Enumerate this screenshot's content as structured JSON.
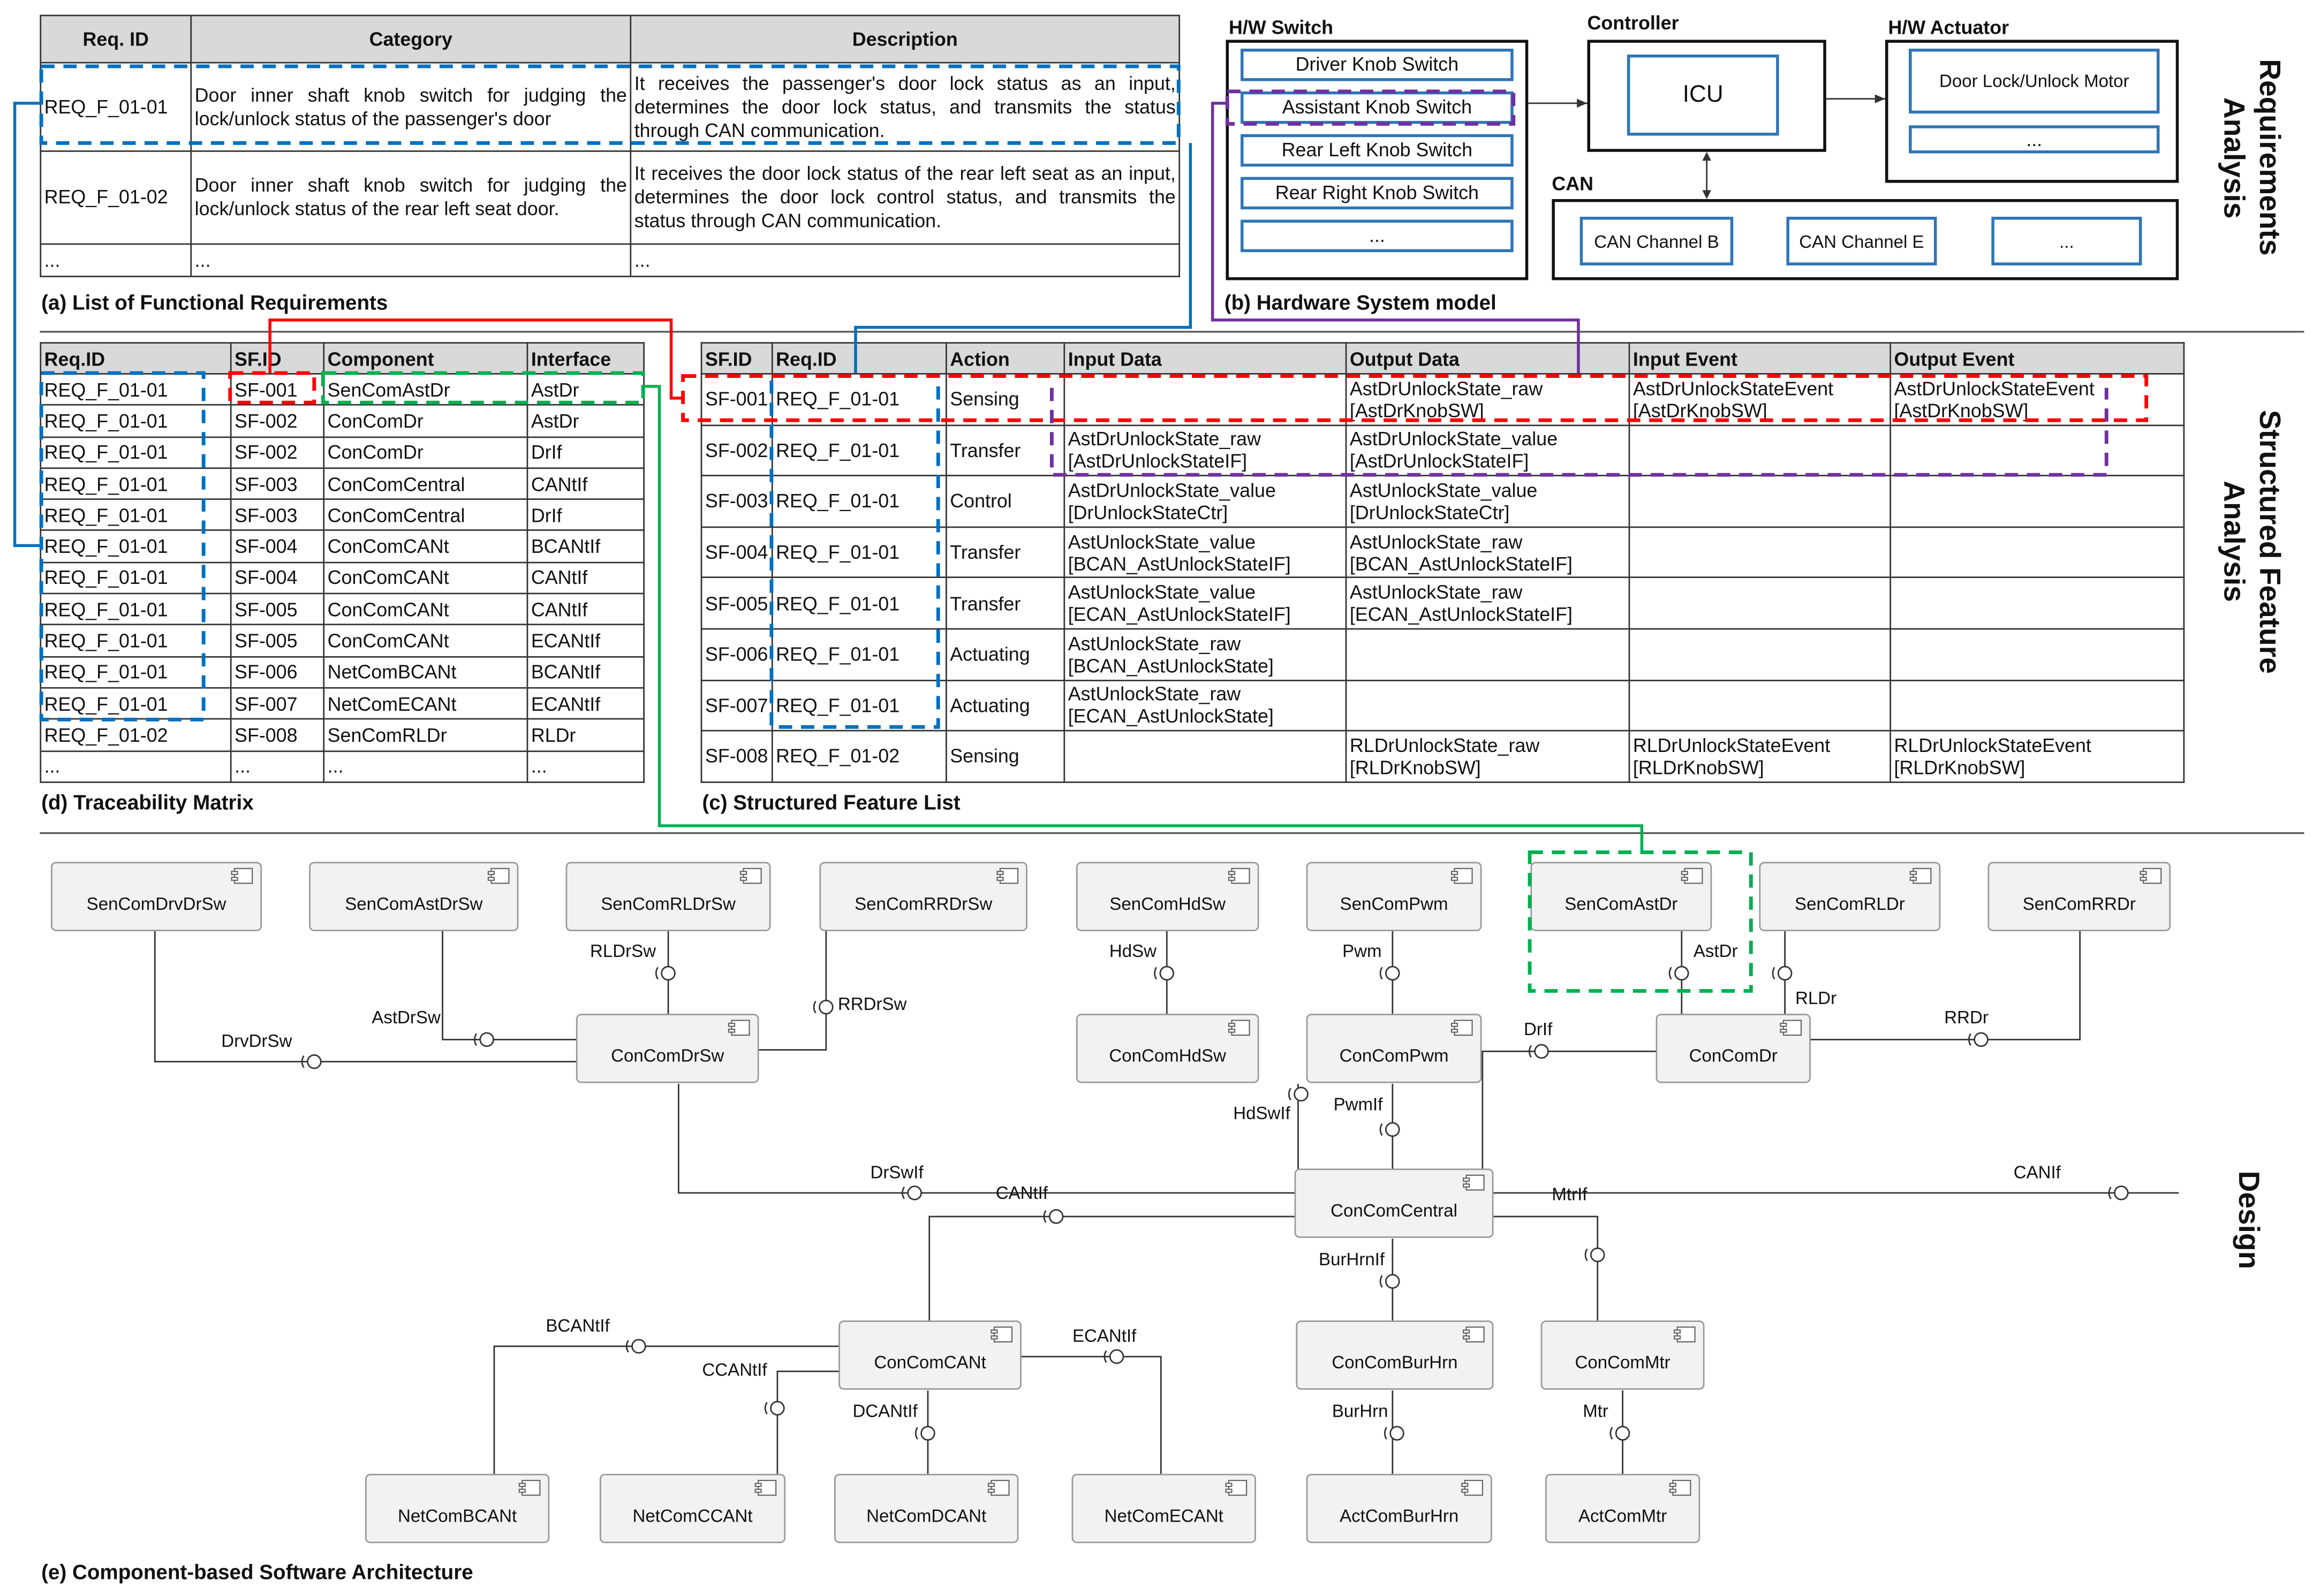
{
  "requirements_table": {
    "caption": "(a) List of Functional Requirements",
    "headers": [
      "Req. ID",
      "Category",
      "Description"
    ],
    "rows": [
      [
        "REQ_F_01-01",
        "Door inner shaft knob switch for judging the lock/unlock status of the passenger's door",
        "It receives the passenger's door lock status as an input, determines the door lock status, and transmits the status through CAN communication."
      ],
      [
        "REQ_F_01-02",
        "Door inner shaft knob switch for judging the lock/unlock status of the rear left seat door.",
        "It receives the door lock status of the rear left seat as an input, determines the door lock control status, and transmits the status through CAN communication."
      ],
      [
        "...",
        "...",
        "..."
      ]
    ]
  },
  "hardware_model": {
    "caption": "(b) Hardware System model",
    "switch_group": "H/W Switch",
    "switches": [
      "Driver Knob Switch",
      "Assistant Knob Switch",
      "Rear Left Knob Switch",
      "Rear Right Knob Switch",
      "..."
    ],
    "controller_group": "Controller",
    "controller": "ICU",
    "actuator_group": "H/W Actuator",
    "actuators": [
      "Door Lock/Unlock Motor",
      "..."
    ],
    "can_group": "CAN",
    "can_channels": [
      "CAN Channel B",
      "CAN Channel E",
      "..."
    ]
  },
  "traceability_matrix": {
    "caption": "(d) Traceability Matrix",
    "headers": [
      "Req.ID",
      "SF.ID",
      "Component",
      "Interface"
    ],
    "rows": [
      [
        "REQ_F_01-01",
        "SF-001",
        "SenComAstDr",
        "AstDr"
      ],
      [
        "REQ_F_01-01",
        "SF-002",
        "ConComDr",
        "AstDr"
      ],
      [
        "REQ_F_01-01",
        "SF-002",
        "ConComDr",
        "DrIf"
      ],
      [
        "REQ_F_01-01",
        "SF-003",
        "ConComCentral",
        "CANtIf"
      ],
      [
        "REQ_F_01-01",
        "SF-003",
        "ConComCentral",
        "DrIf"
      ],
      [
        "REQ_F_01-01",
        "SF-004",
        "ConComCANt",
        "BCANtIf"
      ],
      [
        "REQ_F_01-01",
        "SF-004",
        "ConComCANt",
        "CANtIf"
      ],
      [
        "REQ_F_01-01",
        "SF-005",
        "ConComCANt",
        "CANtIf"
      ],
      [
        "REQ_F_01-01",
        "SF-005",
        "ConComCANt",
        "ECANtIf"
      ],
      [
        "REQ_F_01-01",
        "SF-006",
        "NetComBCANt",
        "BCANtIf"
      ],
      [
        "REQ_F_01-01",
        "SF-007",
        "NetComECANt",
        "ECANtIf"
      ],
      [
        "REQ_F_01-02",
        "SF-008",
        "SenComRLDr",
        "RLDr"
      ],
      [
        "...",
        "...",
        "...",
        "..."
      ]
    ]
  },
  "feature_list": {
    "caption": "(c) Structured Feature List",
    "headers": [
      "SF.ID",
      "Req.ID",
      "Action",
      "Input Data",
      "Output Data",
      "Input Event",
      "Output Event"
    ],
    "rows": [
      [
        "SF-001",
        "REQ_F_01-01",
        "Sensing",
        "",
        "AstDrUnlockState_raw\n[AstDrKnobSW]",
        "AstDrUnlockStateEvent\n[AstDrKnobSW]",
        "AstDrUnlockStateEvent\n[AstDrKnobSW]"
      ],
      [
        "SF-002",
        "REQ_F_01-01",
        "Transfer",
        "AstDrUnlockState_raw\n[AstDrUnlockStateIF]",
        "AstDrUnlockState_value\n[AstDrUnlockStateIF]",
        "",
        ""
      ],
      [
        "SF-003",
        "REQ_F_01-01",
        "Control",
        "AstDrUnlockState_value\n[DrUnlockStateCtr]",
        "AstUnlockState_value\n[DrUnlockStateCtr]",
        "",
        ""
      ],
      [
        "SF-004",
        "REQ_F_01-01",
        "Transfer",
        "AstUnlockState_value\n[BCAN_AstUnlockStateIF]",
        "AstUnlockState_raw\n[BCAN_AstUnlockStateIF]",
        "",
        ""
      ],
      [
        "SF-005",
        "REQ_F_01-01",
        "Transfer",
        "AstUnlockState_value\n[ECAN_AstUnlockStateIF]",
        "AstUnlockState_raw\n[ECAN_AstUnlockStateIF]",
        "",
        ""
      ],
      [
        "SF-006",
        "REQ_F_01-01",
        "Actuating",
        "AstUnlockState_raw\n[BCAN_AstUnlockState]",
        "",
        "",
        ""
      ],
      [
        "SF-007",
        "REQ_F_01-01",
        "Actuating",
        "AstUnlockState_raw\n[ECAN_AstUnlockState]",
        "",
        "",
        ""
      ],
      [
        "SF-008",
        "REQ_F_01-02",
        "Sensing",
        "",
        "RLDrUnlockState_raw\n[RLDrKnobSW]",
        "RLDrUnlockStateEvent\n[RLDrKnobSW]",
        "RLDrUnlockStateEvent\n[RLDrKnobSW]"
      ]
    ]
  },
  "architecture": {
    "caption": "(e) Component-based Software Architecture",
    "components": [
      "SenComDrvDrSw",
      "SenComAstDrSw",
      "SenComRLDrSw",
      "SenComRRDrSw",
      "SenComHdSw",
      "SenComPwm",
      "SenComAstDr",
      "SenComRLDr",
      "SenComRRDr",
      "ConComDrSw",
      "ConComHdSw",
      "ConComPwm",
      "ConComDr",
      "ConComCentral",
      "ConComCANt",
      "ConComBurHrn",
      "ConComMtr",
      "NetComBCANt",
      "NetComCCANt",
      "NetComDCANt",
      "NetComECANt",
      "ActComBurHrn",
      "ActComMtr"
    ],
    "interfaces": [
      "DrvDrSw",
      "AstDrSw",
      "RLDrSw",
      "RRDrSw",
      "DrSwIf",
      "HdSw",
      "HdSwIf",
      "Pwm",
      "PwmIf",
      "AstDr",
      "RLDr",
      "RRDr",
      "DrIf",
      "CANIf",
      "CANtIf",
      "MtrIf",
      "BurHrnIf",
      "BCANtIf",
      "CCANtIf",
      "DCANtIf",
      "ECANtIf",
      "BurHrn",
      "Mtr"
    ]
  },
  "phases": [
    "Requirements Analysis",
    "Structured Feature Analysis",
    "Design"
  ],
  "colors": {
    "blue": "#0070c0",
    "red": "#ff0000",
    "green": "#00b050",
    "purple": "#7030a0",
    "header": "#d9d9d9",
    "box_border": "#2e75b6"
  }
}
